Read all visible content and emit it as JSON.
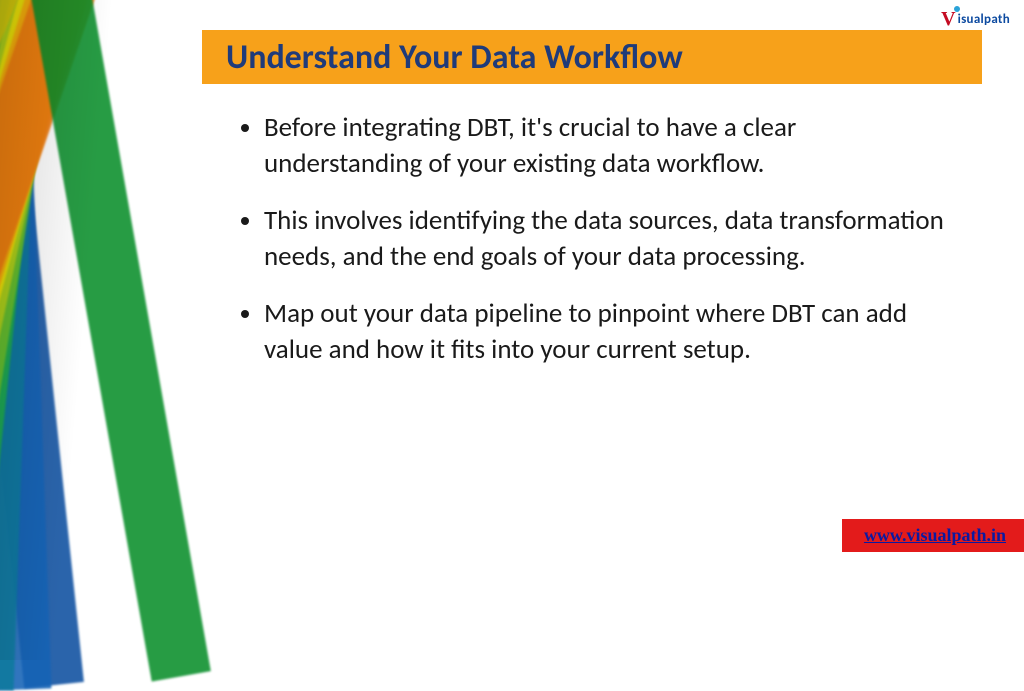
{
  "title": "Understand Your Data Workflow",
  "bullets": [
    "Before integrating DBT, it's crucial to have a clear understanding of your existing data workflow.",
    "This involves identifying the data sources, data transformation needs, and the end goals of your data processing.",
    "Map out your data pipeline to pinpoint where DBT can add value and how it fits into your current setup."
  ],
  "logo": {
    "v": "V",
    "rest": "isualpath"
  },
  "footer_link": {
    "label": "www.visualpath.in",
    "href": "http://www.visualpath.in"
  }
}
